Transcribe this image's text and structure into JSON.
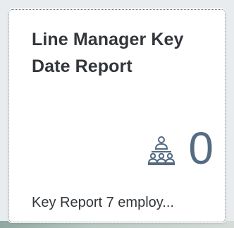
{
  "tile": {
    "title": "Line Manager Key Date Report",
    "kpi_value": "0",
    "kpi_icon": "org-hierarchy-icon",
    "footer": "Key Report 7 employ...",
    "colors": {
      "title": "#32363a",
      "kpi": "#556b82",
      "border": "#6a6d70",
      "background": "#ffffff"
    }
  }
}
